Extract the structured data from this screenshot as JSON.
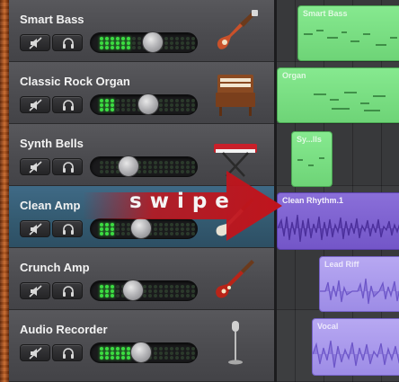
{
  "tracks": [
    {
      "name": "Smart Bass",
      "volume": 0.6,
      "meter_leds_lit": 6,
      "instrument_icon": "bass-guitar-icon",
      "selected": false
    },
    {
      "name": "Classic Rock Organ",
      "volume": 0.55,
      "meter_leds_lit": 3,
      "instrument_icon": "organ-icon",
      "selected": false
    },
    {
      "name": "Synth Bells",
      "volume": 0.3,
      "meter_leds_lit": 0,
      "instrument_icon": "keyboard-icon",
      "selected": false
    },
    {
      "name": "Clean Amp",
      "volume": 0.45,
      "meter_leds_lit": 3,
      "instrument_icon": "electric-guitar-icon",
      "selected": true
    },
    {
      "name": "Crunch Amp",
      "volume": 0.35,
      "meter_leds_lit": 3,
      "instrument_icon": "electric-guitar-icon",
      "selected": false
    },
    {
      "name": "Audio Recorder",
      "volume": 0.45,
      "meter_leds_lit": 6,
      "instrument_icon": "microphone-icon",
      "selected": false
    }
  ],
  "regions": [
    {
      "label": "Smart Bass",
      "kind": "midi"
    },
    {
      "label": "Organ",
      "kind": "midi"
    },
    {
      "label": "Sy...lls",
      "kind": "midi"
    },
    {
      "label": "Clean Rhythm.1",
      "kind": "audio"
    },
    {
      "label": "Lead Riff",
      "kind": "audio"
    },
    {
      "label": "Vocal",
      "kind": "audio"
    }
  ],
  "overlay": {
    "gesture_text": "swipe",
    "arrow_color": "#c0141c"
  },
  "colors": {
    "midi_region": "#7ddf86",
    "audio_region": "#a898ee",
    "selected_header": "#3a6582",
    "meter_on": "#3cdc42"
  }
}
